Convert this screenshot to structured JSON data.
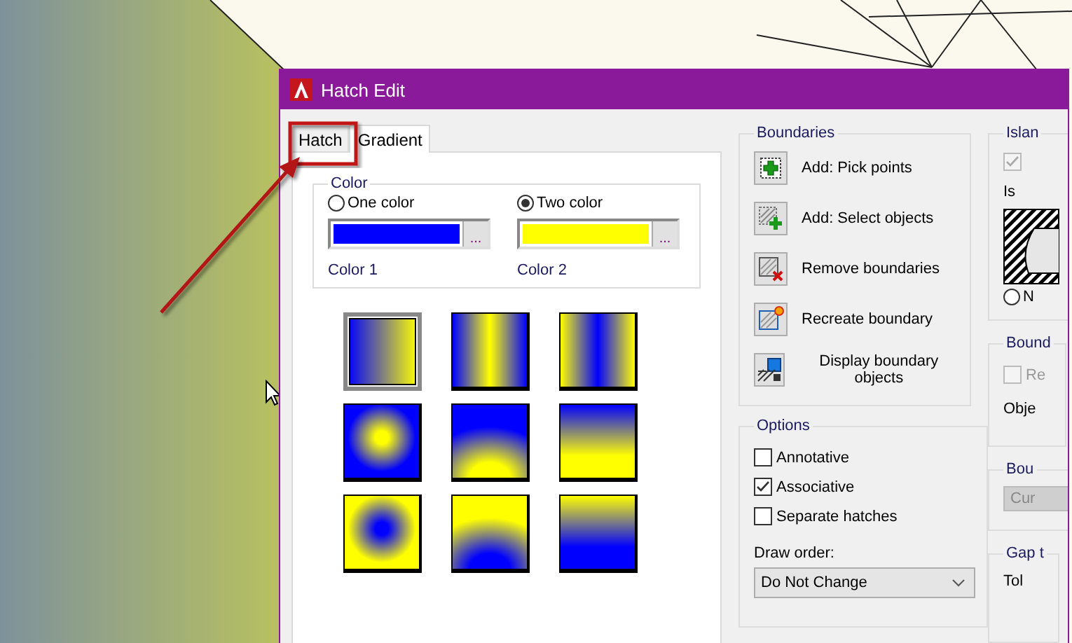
{
  "window": {
    "title": "Hatch Edit"
  },
  "tabs": [
    {
      "label": "Hatch",
      "selected": false
    },
    {
      "label": "Gradient",
      "selected": true
    }
  ],
  "color": {
    "title": "Color",
    "options": [
      {
        "label": "One color",
        "selected": false
      },
      {
        "label": "Two color",
        "selected": true
      }
    ],
    "swatches": [
      {
        "label": "Color 1",
        "color": "#0000ff",
        "button": "..."
      },
      {
        "label": "Color 2",
        "color": "#ffff00",
        "button": "..."
      }
    ]
  },
  "patterns": [
    {
      "kind": "linear",
      "selected": true
    },
    {
      "kind": "cylinder",
      "selected": false
    },
    {
      "kind": "invcylinder",
      "selected": false
    },
    {
      "kind": "spherical",
      "selected": false
    },
    {
      "kind": "hemispherical",
      "selected": false
    },
    {
      "kind": "curved",
      "selected": false
    },
    {
      "kind": "invspherical",
      "selected": false
    },
    {
      "kind": "invhemispherical",
      "selected": false
    },
    {
      "kind": "invcurved",
      "selected": false
    }
  ],
  "boundaries": {
    "title": "Boundaries",
    "buttons": [
      {
        "kind": "pick",
        "label": "Add: Pick points"
      },
      {
        "kind": "select",
        "label": "Add: Select objects"
      },
      {
        "kind": "remove",
        "label": "Remove boundaries"
      },
      {
        "kind": "recreate",
        "label": "Recreate boundary"
      },
      {
        "kind": "display",
        "label": "Display boundary objects"
      }
    ]
  },
  "options": {
    "title": "Options",
    "checkboxes": [
      {
        "label": "Annotative",
        "checked": false
      },
      {
        "label": "Associative",
        "checked": true
      },
      {
        "label": "Separate hatches",
        "checked": false
      }
    ],
    "draw_order": {
      "label": "Draw order:",
      "value": "Do Not Change"
    }
  },
  "islands": {
    "title": "Islan",
    "checked": true,
    "disabled": true,
    "style_label": "Is",
    "radio_label": "N",
    "radio_selected": false
  },
  "boundary_retention": {
    "title": "Bound",
    "check_label": "Re",
    "checked": false,
    "object_label": "Obje"
  },
  "boundary_set": {
    "title": "Bou",
    "button": "Cur"
  },
  "gap": {
    "title": "Gap t",
    "label": "Tol"
  }
}
